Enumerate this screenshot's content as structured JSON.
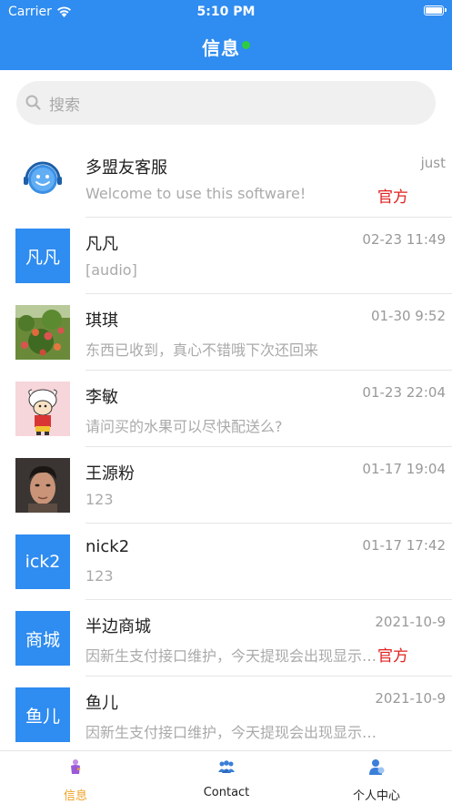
{
  "status_bar": {
    "carrier": "Carrier",
    "time": "5:10 PM"
  },
  "header": {
    "title": "信息",
    "online_color": "#2ecc40",
    "bg_color": "#2f8cf0"
  },
  "search": {
    "placeholder": "搜索",
    "icon": "search-icon"
  },
  "conversations": [
    {
      "name": "多盟友客服",
      "time": "just",
      "preview": "Welcome to use this software!",
      "badge": "官方",
      "avatar": "customer-service-avatar"
    },
    {
      "name": "凡凡",
      "time": "02-23 11:49",
      "preview": "[audio]",
      "badge": "",
      "avatar_text": "凡凡"
    },
    {
      "name": "琪琪",
      "time": "01-30 9:52",
      "preview": "东西已收到，真心不错哦下次还回来",
      "badge": "",
      "avatar": "peach-tree-photo"
    },
    {
      "name": "李敏",
      "time": "01-23 22:04",
      "preview": "请问买的水果可以尽快配送么?",
      "badge": "",
      "avatar": "cartoon-boy-avatar"
    },
    {
      "name": "王源粉",
      "time": "01-17 19:04",
      "preview": "123",
      "badge": "",
      "avatar": "man-portrait-photo"
    },
    {
      "name": "nick2",
      "time": "01-17 17:42",
      "preview": "123",
      "badge": "",
      "avatar_text": "ick2"
    },
    {
      "name": "半边商城",
      "time": "2021-10-9",
      "preview": "因新生支付接口维护，今天提现会出现显示…",
      "badge": "官方",
      "avatar_text": "商城"
    },
    {
      "name": "鱼儿",
      "time": "2021-10-9",
      "preview": "因新生支付接口维护，今天提现会出现显示…",
      "badge": "",
      "avatar_text": "鱼儿"
    }
  ],
  "tabbar": [
    {
      "label": "信息",
      "icon": "message-icon",
      "active": true
    },
    {
      "label": "Contact",
      "icon": "contacts-icon",
      "active": false
    },
    {
      "label": "个人中心",
      "icon": "profile-icon",
      "active": false
    }
  ],
  "colors": {
    "accent": "#2f8cf0",
    "official_badge": "#e02020",
    "active_tab": "#f0a020"
  }
}
